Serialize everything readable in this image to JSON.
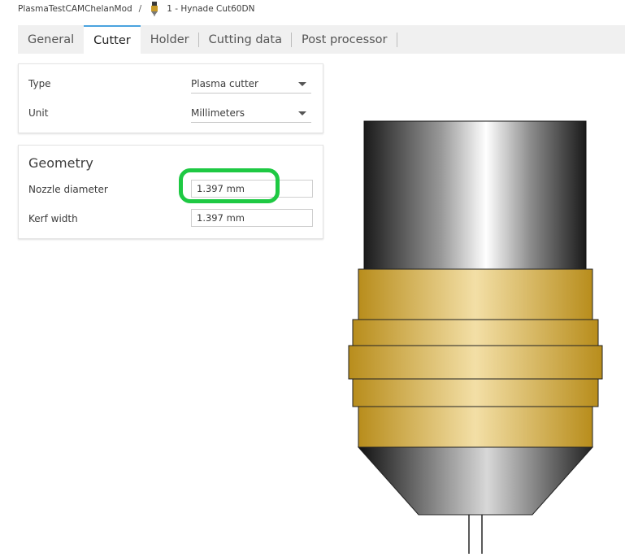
{
  "breadcrumb": {
    "document": "PlasmaTestCAMChelanMod",
    "separator": "/",
    "tool_icon": "plasma-torch-icon",
    "tool": "1 - Hynade Cut60DN"
  },
  "tabs": [
    {
      "label": "General"
    },
    {
      "label": "Cutter"
    },
    {
      "label": "Holder"
    },
    {
      "label": "Cutting data"
    },
    {
      "label": "Post processor"
    }
  ],
  "active_tab": "Cutter",
  "settings": {
    "type_label": "Type",
    "type_value": "Plasma cutter",
    "unit_label": "Unit",
    "unit_value": "Millimeters"
  },
  "geometry": {
    "title": "Geometry",
    "nozzle_label": "Nozzle diameter",
    "nozzle_value": "1.397 mm",
    "kerf_label": "Kerf width",
    "kerf_value": "1.397 mm"
  },
  "colors": {
    "accent": "#4aa3df",
    "highlight": "#1ec943",
    "brass": "#c89b2a"
  }
}
